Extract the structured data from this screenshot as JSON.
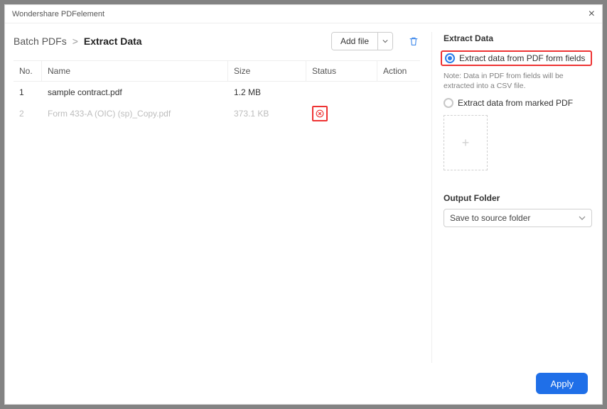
{
  "window": {
    "title": "Wondershare PDFelement"
  },
  "breadcrumb": {
    "root": "Batch PDFs",
    "sep": ">",
    "current": "Extract Data"
  },
  "toolbar": {
    "add_file": "Add file"
  },
  "table": {
    "headers": {
      "no": "No.",
      "name": "Name",
      "size": "Size",
      "status": "Status",
      "action": "Action"
    },
    "rows": [
      {
        "no": "1",
        "name": "sample contract.pdf",
        "size": "1.2 MB",
        "status": "",
        "disabled": false
      },
      {
        "no": "2",
        "name": "Form 433-A (OIC) (sp)_Copy.pdf",
        "size": "373.1 KB",
        "status": "error",
        "disabled": true
      }
    ]
  },
  "side": {
    "heading": "Extract Data",
    "option1_label": "Extract data from PDF form fields",
    "note": "Note: Data in PDF from fields will be extracted into a CSV file.",
    "option2_label": "Extract data from marked PDF",
    "output_label": "Output Folder",
    "output_value": "Save to source folder"
  },
  "footer": {
    "apply": "Apply"
  }
}
